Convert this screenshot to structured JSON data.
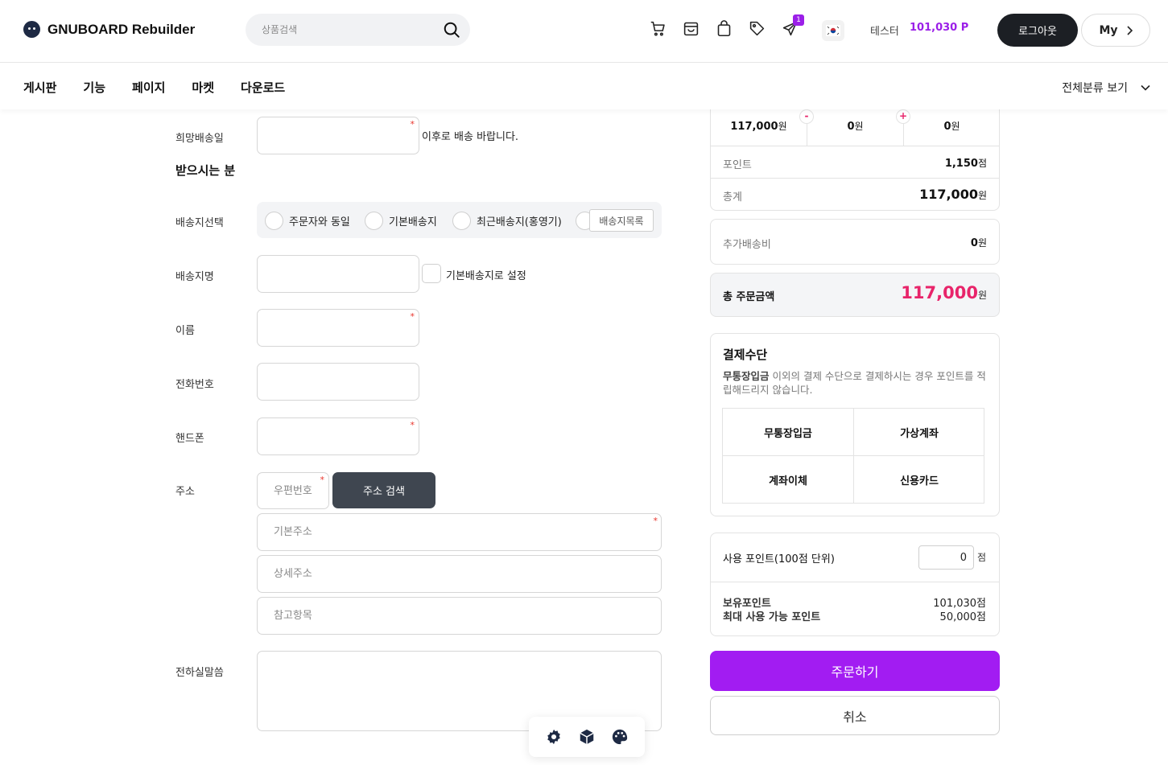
{
  "header": {
    "logo_text": "GNUBOARD Rebuilder",
    "search_placeholder": "상품검색",
    "notification_count": "1",
    "user_name": "테스터",
    "user_points": "101,030 P",
    "logout_label": "로그아웃",
    "my_label": "My",
    "icons": [
      "cart-icon",
      "box-icon",
      "shopping-bag-icon",
      "tag-icon",
      "send-icon",
      "flag-icon"
    ]
  },
  "nav": {
    "items": [
      "게시판",
      "기능",
      "페이지",
      "마켓",
      "다운로드"
    ],
    "all_categories": "전체분류 보기"
  },
  "form": {
    "delivery_date_label": "희망배송일",
    "delivery_date_suffix": "이후로 배송 바랍니다.",
    "recipient_title": "받으시는 분",
    "address_select_label": "배송지선택",
    "radio_options": [
      "주문자와 동일",
      "기본배송지",
      "최근배송지(홍영기)"
    ],
    "address_list_button": "배송지목록",
    "address_name_label": "배송지명",
    "default_address_check": "기본배송지로 설정",
    "name_label": "이름",
    "phone_label": "전화번호",
    "mobile_label": "핸드폰",
    "address_label": "주소",
    "zip_placeholder": "우편번호",
    "address_search_button": "주소 검색",
    "address_basic_placeholder": "기본주소",
    "address_detail_placeholder": "상세주소",
    "address_ref_placeholder": "참고항목",
    "message_label": "전하실말씀"
  },
  "summary": {
    "col1_value": "117,000",
    "col2_value": "0",
    "col3_value": "0",
    "won": "원",
    "minus": "-",
    "plus": "+",
    "points_label": "포인트",
    "points_value": "1,150",
    "points_unit": "점",
    "total_label": "총계",
    "total_value": "117,000",
    "extra_shipping_label": "추가배송비",
    "extra_shipping_value": "0",
    "order_total_label": "총 주문금액",
    "order_total_value": "117,000"
  },
  "payment": {
    "title": "결제수단",
    "desc_bold": "무통장입금",
    "desc_rest": " 이외의 결제 수단으로 결제하시는 경우 포인트를 적립해드리지 않습니다.",
    "methods": [
      "무통장입금",
      "가상계좌",
      "계좌이체",
      "신용카드"
    ]
  },
  "points": {
    "use_label": "사용 포인트(100점 단위)",
    "use_value": "0",
    "use_unit": "점",
    "owned_label": "보유포인트",
    "owned_value": "101,030점",
    "max_label": "최대 사용 가능 포인트",
    "max_value": "50,000점"
  },
  "actions": {
    "order_label": "주문하기",
    "cancel_label": "취소"
  },
  "colors": {
    "accent_purple": "#a21cf2",
    "total_pink": "#e8246a",
    "dark": "#1c1f24"
  }
}
